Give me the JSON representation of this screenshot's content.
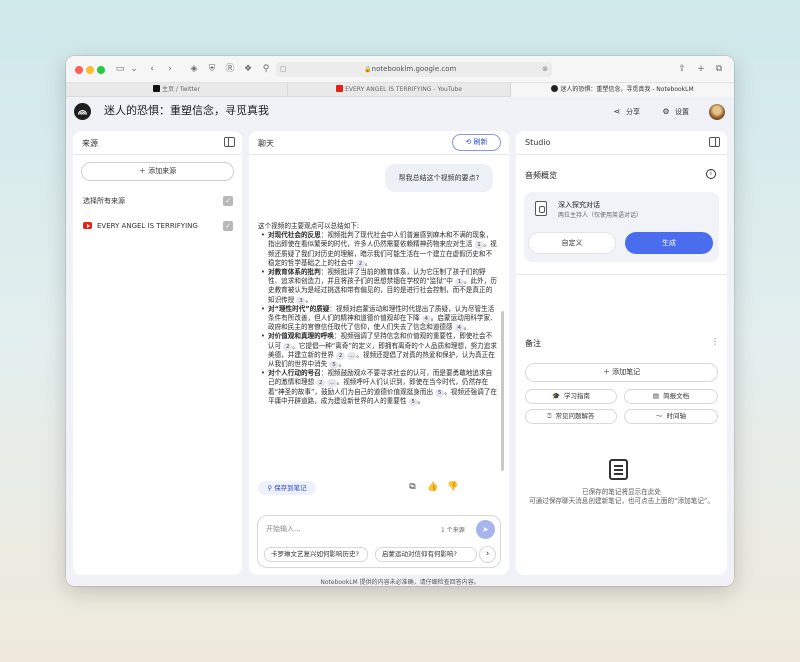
{
  "browser": {
    "url": "notebooklm.google.com",
    "tabs": [
      {
        "label": "主页 / Twitter",
        "favicon": "x-logo-icon"
      },
      {
        "label": "EVERY ANGEL IS TERRIFYING - YouTube",
        "favicon": "youtube-icon"
      },
      {
        "label": "迷人的恐惧：重塑信念，寻觅真我 - NotebookLM",
        "favicon": "notebooklm-icon"
      }
    ]
  },
  "header": {
    "title": "迷人的恐惧：重塑信念，寻觅真我",
    "share_label": "分享",
    "settings_label": "设置"
  },
  "sources": {
    "title": "来源",
    "add_label": "添加来源",
    "select_all_label": "选择所有来源",
    "items": [
      {
        "label": "EVERY ANGEL IS TERRIFYING",
        "type": "youtube",
        "checked": true
      }
    ]
  },
  "chat": {
    "title": "聊天",
    "refresh_label": "刷新",
    "user_message": "帮我总结这个视频的要点?",
    "answer_lead": "这个视频的主要观点可以总结如下:",
    "points": [
      {
        "bold": "对现代社会的反思",
        "parts": [
          {
            "t": "：视频批判了现代社会中人们普遍感到麻木和不满的现象，指出即使在看似繁荣的时代，许多人仍然需要依赖精神药物来应对生活 "
          },
          {
            "c": "1"
          },
          {
            "t": "。视频还质疑了我们对历史的理解，暗示我们可能生活在一个建立在虚假历史和不稳定的哲学基础之上的社会中 "
          },
          {
            "c": "2"
          },
          {
            "t": "。"
          }
        ]
      },
      {
        "bold": "对教育体系的批判",
        "parts": [
          {
            "t": "：视频批评了当前的教育体系，认为它压制了孩子们的野性、追求和创造力，并且将孩子们的思想禁锢在学校的“监狱”中 "
          },
          {
            "c": "1"
          },
          {
            "t": "。此外，历史教育被认为是经过挑选和带有偏见的，目的是进行社会控制，而不是真正的知识传授 "
          },
          {
            "c": "3"
          },
          {
            "t": "。"
          }
        ]
      },
      {
        "bold": "对“理性时代”的质疑",
        "parts": [
          {
            "t": "：视频对启蒙运动和理性时代提出了质疑，认为尽管生活条件有所改善，但人们的精神和道德价值观却在下降 "
          },
          {
            "c": "4"
          },
          {
            "t": "。启蒙运动用科学家、政府和民主的官僚信任取代了信仰，使人们失去了信念和道德感 "
          },
          {
            "c": "4"
          },
          {
            "t": "。"
          }
        ]
      },
      {
        "bold": "对价值观和真理的呼唤",
        "parts": [
          {
            "t": "：视频强调了坚持信念和价值观的重要性，即使社会不认可 "
          },
          {
            "c": "2"
          },
          {
            "t": "。它提倡一种“离奇”的定义，即拥有离奇的个人品质和理想，努力追求美德，并建立新的世界 "
          },
          {
            "c": "2"
          },
          {
            "t": " "
          },
          {
            "c": "..."
          },
          {
            "t": "。视频还提倡了对真的热爱和保护，认为真正在从我们的世界中消失 "
          },
          {
            "c": "5"
          },
          {
            "t": "。"
          }
        ]
      },
      {
        "bold": "对个人行动的号召",
        "parts": [
          {
            "t": "：视频鼓励观众不要寻求社会的认可，而是要勇敢地追求自己的激情和理想 "
          },
          {
            "c": "2"
          },
          {
            "t": " "
          },
          {
            "c": "..."
          },
          {
            "t": "。视频呼吁人们认识到，即使在当今时代，仍然存在着“神圣的故事”，鼓励人们为自己的道德价值观挺身而出 "
          },
          {
            "c": "5"
          },
          {
            "t": "。视频还强调了在平庸中开辟道路，成为建设新世界的人的重要性 "
          },
          {
            "c": "5"
          },
          {
            "t": "。"
          }
        ]
      }
    ],
    "save_note_label": "保存到笔记",
    "composer": {
      "placeholder": "开始输入...",
      "source_count": "1 个来源"
    },
    "suggestions": [
      "卡罗琳文艺复兴如何影响历史?",
      "启蒙运动对信仰有何影响?"
    ]
  },
  "studio": {
    "title": "Studio",
    "audio_overview": {
      "title": "音频概览",
      "card_title": "深入探究对话",
      "card_subtitle": "两位主持人（仅使用英语对话）",
      "customize_label": "自定义",
      "generate_label": "生成"
    },
    "notes": {
      "title": "备注",
      "add_label": "添加笔记",
      "chips": [
        {
          "label": "学习指南",
          "icon": "graduation-cap-icon"
        },
        {
          "label": "简报文档",
          "icon": "document-icon"
        },
        {
          "label": "常见问题解答",
          "icon": "faq-icon"
        },
        {
          "label": "时间轴",
          "icon": "timeline-icon"
        }
      ],
      "empty_title": "已保存的笔记将显示在此处",
      "empty_hint": "可通过保存聊天消息创建新笔记，也可点击上面的“添加笔记”。"
    }
  },
  "footer": "NotebookLM 提供的内容未必准确，请仔细检查回答内容。",
  "colors": {
    "accent": "#4a6df0",
    "youtube": "#e62117"
  }
}
